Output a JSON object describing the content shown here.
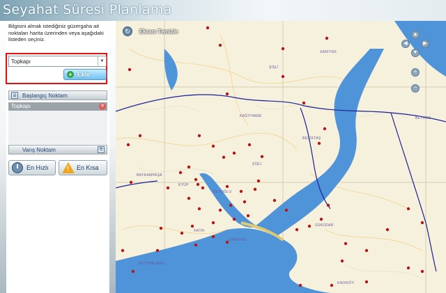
{
  "app": {
    "title": "Seyahat Süresi Planlama"
  },
  "sidebar": {
    "info_text": "Bilgisini almak istediğiniz güzergaha ait noktaları harita üzerinden veya aşağıdaki listeden seçiniz.",
    "select_value": "Topkapı",
    "add_label": "Ekle",
    "start_label": "Başlangıç Noktam",
    "stops": [
      "Topkapı"
    ],
    "end_label": "Varış Noktam",
    "fastest_label": "En Hızlı",
    "shortest_label": "En Kısa"
  },
  "map": {
    "clear_label": "Ekranı Temizle",
    "districts": [
      "SARIYER",
      "ŞİŞLİ",
      "KAĞITHANE",
      "BEŞİKTAŞ",
      "BEYKOZ",
      "ŞİŞLİ",
      "BAYRAMPAŞA",
      "EYÜP",
      "BEYOĞLU",
      "FATİH",
      "ÜSKÜDAR",
      "EMİNÖNÜ",
      "ZEYTİNBURNU",
      "KADIKÖY"
    ],
    "icons": [
      "clear-icon",
      "pan-up-icon",
      "pan-left-icon",
      "pan-right-icon",
      "pan-down-icon",
      "zoom-in-icon",
      "zoom-out-icon"
    ]
  },
  "colors": {
    "water": "#4f93d8",
    "stop_marker": "#b31818",
    "highway": "#1b1f9a",
    "highlight": "#e01010"
  }
}
